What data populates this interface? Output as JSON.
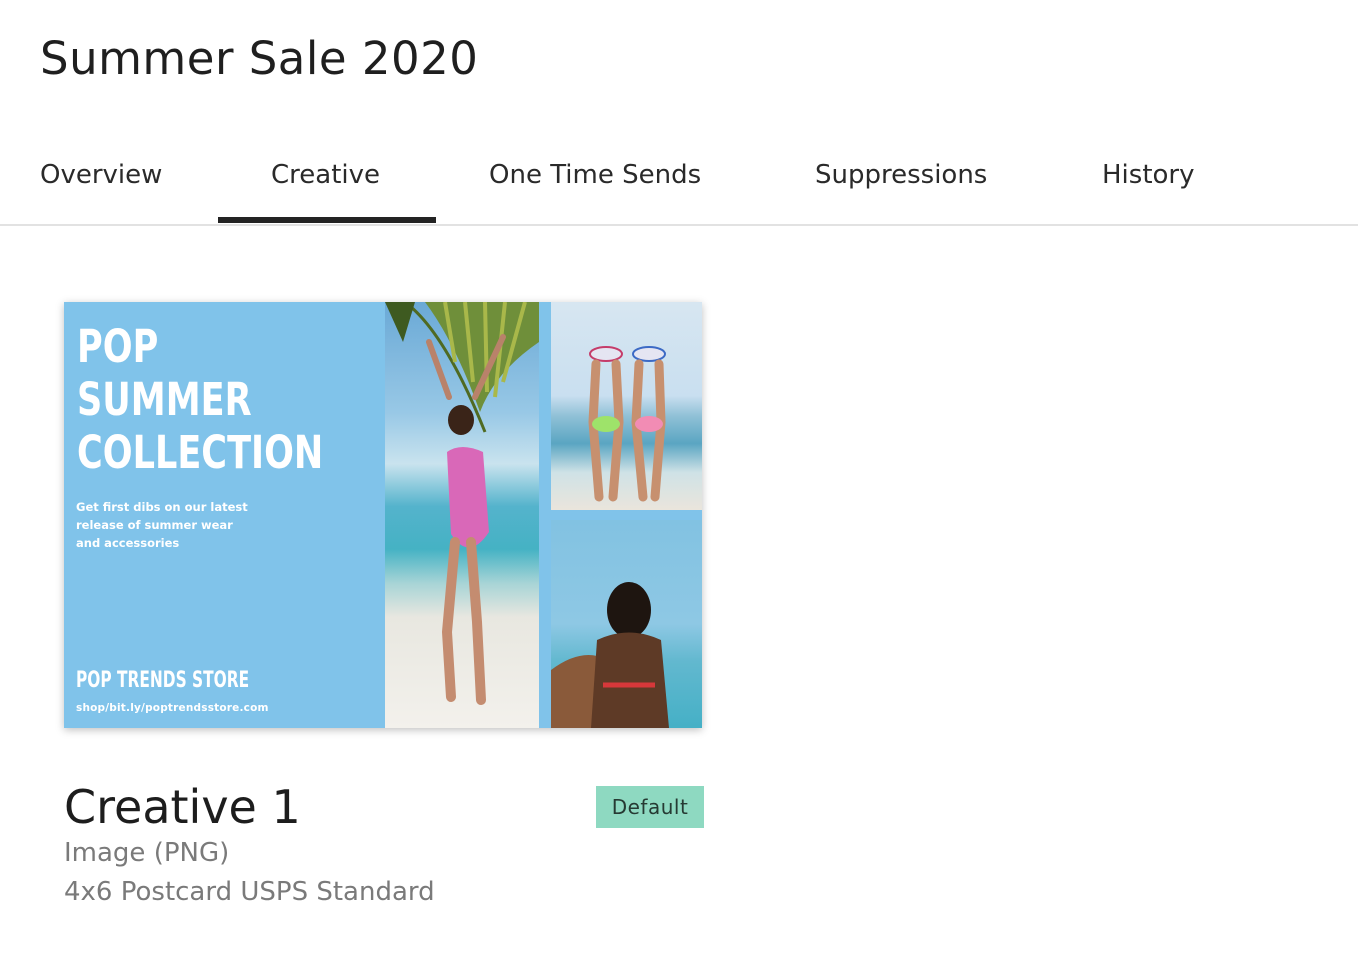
{
  "page": {
    "title": "Summer Sale 2020"
  },
  "tabs": [
    {
      "label": "Overview",
      "active": false
    },
    {
      "label": "Creative",
      "active": true
    },
    {
      "label": "One Time Sends",
      "active": false
    },
    {
      "label": "Suppressions",
      "active": false
    },
    {
      "label": "History",
      "active": false
    }
  ],
  "creative": {
    "name": "Creative 1",
    "badge": "Default",
    "format": "Image (PNG)",
    "size": "4x6 Postcard USPS Standard",
    "thumbnail": {
      "headline_lines": [
        "POP",
        "SUMMER",
        "COLLECTION"
      ],
      "tagline_lines": [
        "Get first dibs on our latest",
        "release of summer wear",
        "and accessories"
      ],
      "store_name": "POP TRENDS STORE",
      "store_url": "shop/bit.ly/poptrendsstore.com"
    }
  },
  "colors": {
    "postcard_blue": "#80c3ea",
    "badge_green": "#8ed9c1",
    "active_tab_underline": "#232323"
  }
}
